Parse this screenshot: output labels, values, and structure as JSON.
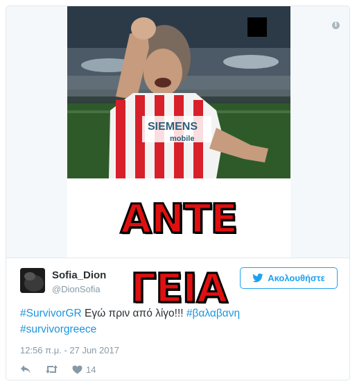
{
  "media": {
    "caption": "ΑΝΤΕ ΓΕΙΑ",
    "jersey_text_1": "SIEMENS",
    "jersey_text_2": "mobile"
  },
  "user": {
    "display_name": "Sofia_Dion",
    "handle": "@DionSofia"
  },
  "follow_button": {
    "label": "Ακολουθήστε",
    "icon": "bird-icon"
  },
  "tweet": {
    "hashtag_1": "#SurvivorGR",
    "text": " Εγώ πριν από λίγο!!! ",
    "hashtag_2": "#βαλαβανη",
    "hashtag_3": "#survivorgreece"
  },
  "timestamp": "12:56 π.μ. - 27 Jun 2017",
  "actions": {
    "reply_icon": "reply-icon",
    "retweet_icon": "retweet-icon",
    "like_icon": "heart-icon",
    "like_count": "14"
  },
  "colors": {
    "link": "#1b95e0",
    "follow": "#1da1f2",
    "muted": "#8899a6",
    "caption_red": "#e01010"
  }
}
